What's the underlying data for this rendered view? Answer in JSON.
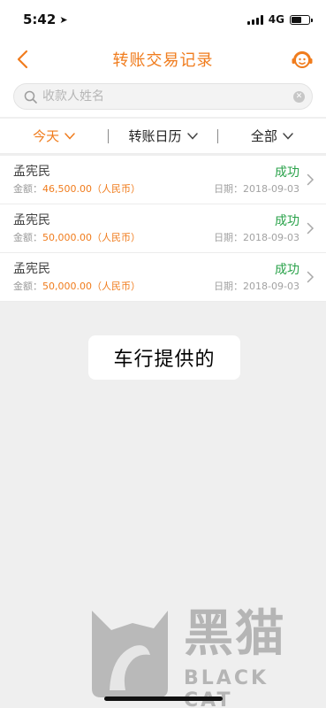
{
  "status": {
    "time": "5:42",
    "location_glyph": "➤",
    "network": "4G"
  },
  "nav": {
    "title": "转账交易记录"
  },
  "search": {
    "placeholder": "收款人姓名",
    "clear_glyph": "✕"
  },
  "filters": [
    {
      "label": "今天",
      "active": true
    },
    {
      "label": "转账日历",
      "active": false
    },
    {
      "label": "全部",
      "active": false
    }
  ],
  "records": [
    {
      "name": "孟宪民",
      "amount_label": "金额：",
      "amount": "46,500.00（人民币）",
      "status": "成功",
      "date": "日期：2018-09-03"
    },
    {
      "name": "孟宪民",
      "amount_label": "金额：",
      "amount": "50,000.00（人民币）",
      "status": "成功",
      "date": "日期：2018-09-03"
    },
    {
      "name": "孟宪民",
      "amount_label": "金额：",
      "amount": "50,000.00（人民币）",
      "status": "成功",
      "date": "日期：2018-09-03"
    }
  ],
  "caption": "车行提供的",
  "watermark": {
    "title": "黑猫",
    "subtitle": "BLACK CAT"
  },
  "colors": {
    "accent": "#f07c1d",
    "success": "#2aa24a"
  }
}
